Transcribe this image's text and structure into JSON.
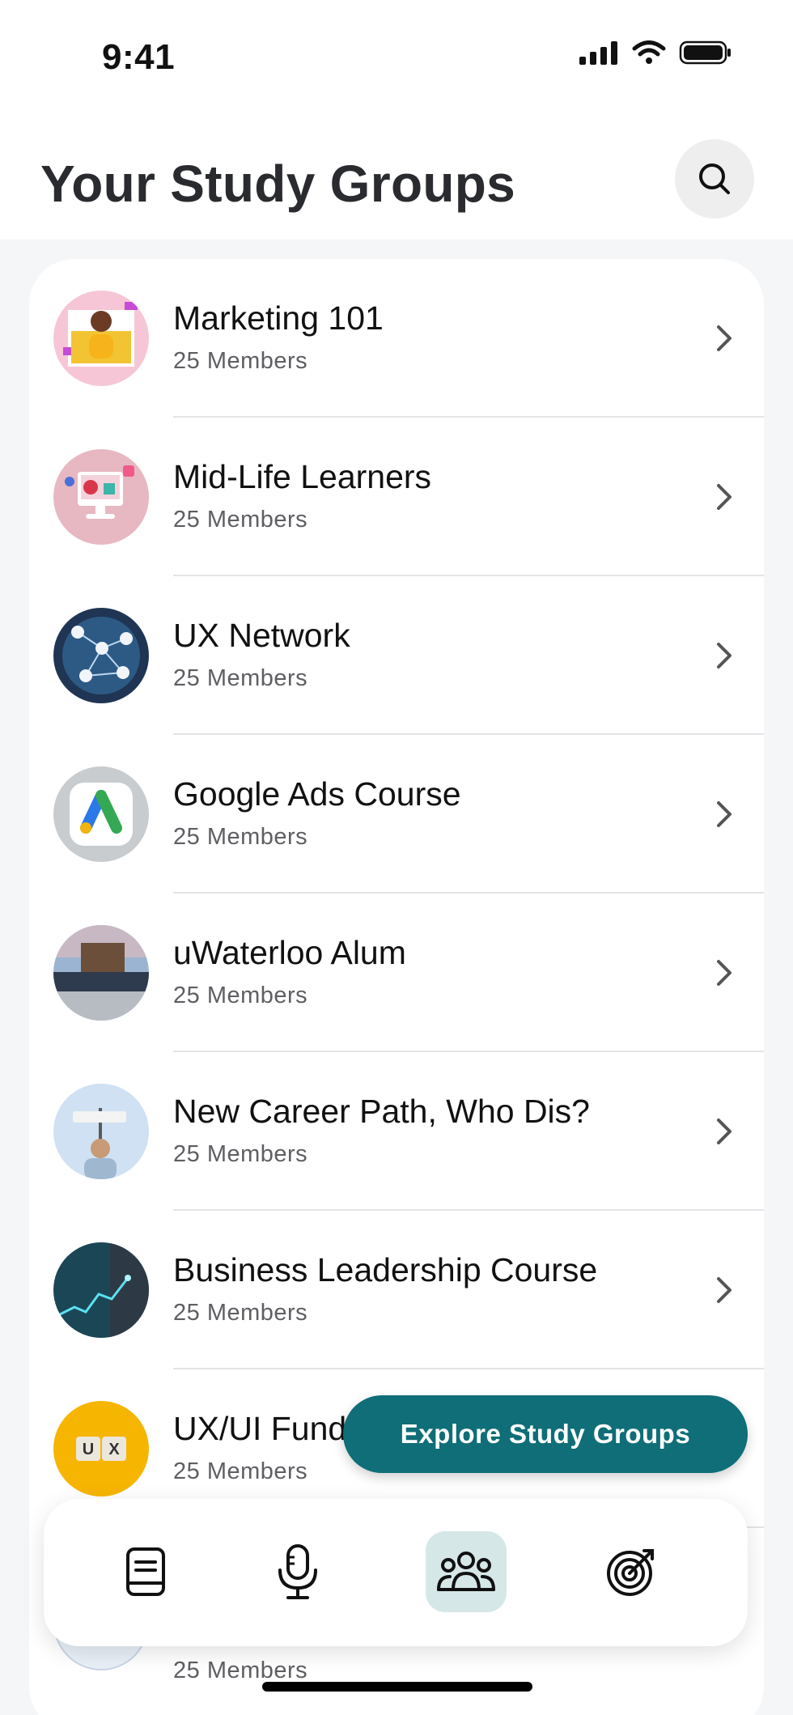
{
  "status_bar": {
    "time": "9:41"
  },
  "header": {
    "title": "Your Study Groups"
  },
  "groups": [
    {
      "name": "Marketing 101",
      "members": "25 Members"
    },
    {
      "name": "Mid-Life Learners",
      "members": "25 Members"
    },
    {
      "name": "UX Network",
      "members": "25 Members"
    },
    {
      "name": "Google Ads Course",
      "members": "25 Members"
    },
    {
      "name": "uWaterloo Alum",
      "members": "25 Members"
    },
    {
      "name": "New Career Path, Who Dis?",
      "members": "25 Members"
    },
    {
      "name": "Business Leadership Course",
      "members": "25 Members"
    },
    {
      "name": "UX/UI Fund",
      "members": "25 Members"
    }
  ],
  "peek_row": {
    "members": "25 Members"
  },
  "explore_button": {
    "label": "Explore Study Groups"
  },
  "tabbar": {
    "tabs": [
      {
        "icon": "book-icon",
        "active": false
      },
      {
        "icon": "microphone-icon",
        "active": false
      },
      {
        "icon": "groups-icon",
        "active": true
      },
      {
        "icon": "target-icon",
        "active": false
      }
    ]
  },
  "colors": {
    "accent": "#0f6e77",
    "tab_active_bg": "#d6e7e8",
    "background": "#f5f6f7"
  }
}
